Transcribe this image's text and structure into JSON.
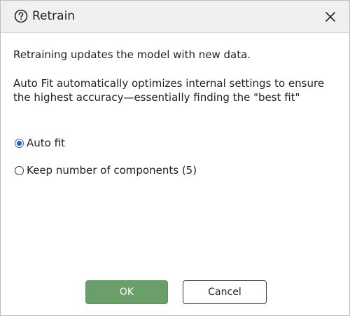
{
  "dialog": {
    "title": "Retrain",
    "help_icon": "question-circle-icon",
    "close_icon": "close-x-icon"
  },
  "content": {
    "paragraph_1": "Retraining updates the model with new data.",
    "paragraph_2": "Auto Fit automatically optimizes internal settings to ensure the highest accuracy—essentially finding the \"best fit\""
  },
  "options": [
    {
      "label": "Auto fit",
      "selected": true
    },
    {
      "label": "Keep number of components (5)",
      "selected": false
    }
  ],
  "buttons": {
    "ok_label": "OK",
    "cancel_label": "Cancel"
  },
  "colors": {
    "ok_button": "#6a9f6a",
    "radio_selected": "#1f5fbf",
    "titlebar": "#f0f0f0"
  }
}
